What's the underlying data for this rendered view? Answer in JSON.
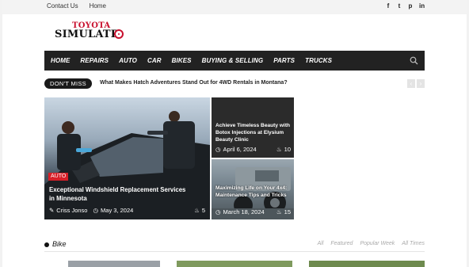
{
  "topbar": {
    "links": [
      "Contact Us",
      "Home"
    ],
    "social": [
      {
        "icon": "facebook-icon",
        "glyph": "f"
      },
      {
        "icon": "twitter-icon",
        "glyph": "t"
      },
      {
        "icon": "pinterest-icon",
        "glyph": "p"
      },
      {
        "icon": "linkedin-icon",
        "glyph": "in"
      }
    ]
  },
  "logo": {
    "line1": "TOYOTA",
    "line2": "SIMULATR"
  },
  "nav": {
    "items": [
      "HOME",
      "REPAIRS",
      "AUTO",
      "CAR",
      "BIKES",
      "BUYING & SELLING",
      "PARTS",
      "TRUCKS"
    ]
  },
  "ticker": {
    "badge": "DON'T MISS",
    "headline": "What Makes Hatch Adventures Stand Out for 4WD Rentals in Montana?"
  },
  "featured": {
    "main": {
      "tag": "AUTO",
      "title": "Exceptional Windshield Replacement Services in Minnesota",
      "author": "Criss Jonso",
      "date": "May 3, 2024",
      "views": "5"
    },
    "side": [
      {
        "title": "Achieve Timeless Beauty with Botox Injections at Elysium Beauty Clinic",
        "date": "April 6, 2024",
        "views": "10"
      },
      {
        "title": "Maximizing Life on Your 4x4: Maintenance Tips and Tricks",
        "date": "March 18, 2024",
        "views": "15"
      }
    ]
  },
  "section": {
    "label": "Bike",
    "filters": [
      "All",
      "Featured",
      "Popular Week",
      "All Times"
    ]
  },
  "colors": {
    "accent": "#d71f28",
    "nav_bg": "#222222"
  }
}
